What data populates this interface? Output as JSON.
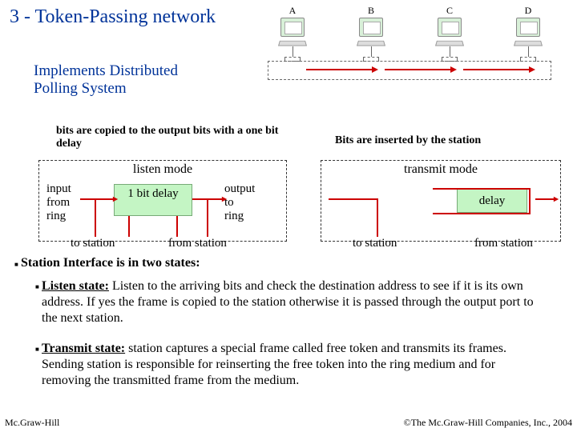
{
  "title": "3 - Token-Passing network",
  "subtitle_l1": "Implements Distributed",
  "subtitle_l2": "Polling System",
  "stations": {
    "a": "A",
    "b": "B",
    "c": "C",
    "d": "D"
  },
  "captions": {
    "left": "bits are copied to the output bits with a one bit delay",
    "right": "Bits are inserted by the station"
  },
  "listen": {
    "title": "listen mode",
    "box": "1 bit delay",
    "in_l1": "input",
    "in_l2": "from",
    "in_l3": "ring",
    "out_l1": "output",
    "out_l2": "to",
    "out_l3": "ring",
    "to": "to station",
    "from": "from station"
  },
  "transmit": {
    "title": "transmit mode",
    "box": "delay",
    "to": "to station",
    "from": "from station"
  },
  "section": "Station Interface is in two states:",
  "listen_state_head": "Listen state:",
  "listen_state_body": " Listen to the arriving bits and check the destination address to see if it is its own address. If yes the frame is copied to the station otherwise it is passed through the output port to the next station.",
  "transmit_state_head": "Transmit state:",
  "transmit_state_body": " station captures a special frame called  free token and transmits its frames. Sending station is responsible for reinserting the free token into the ring medium and for removing the transmitted frame from the medium.",
  "footer": {
    "left": "Mc.Graw-Hill",
    "right": "©The Mc.Graw-Hill Companies, Inc., 2004"
  }
}
